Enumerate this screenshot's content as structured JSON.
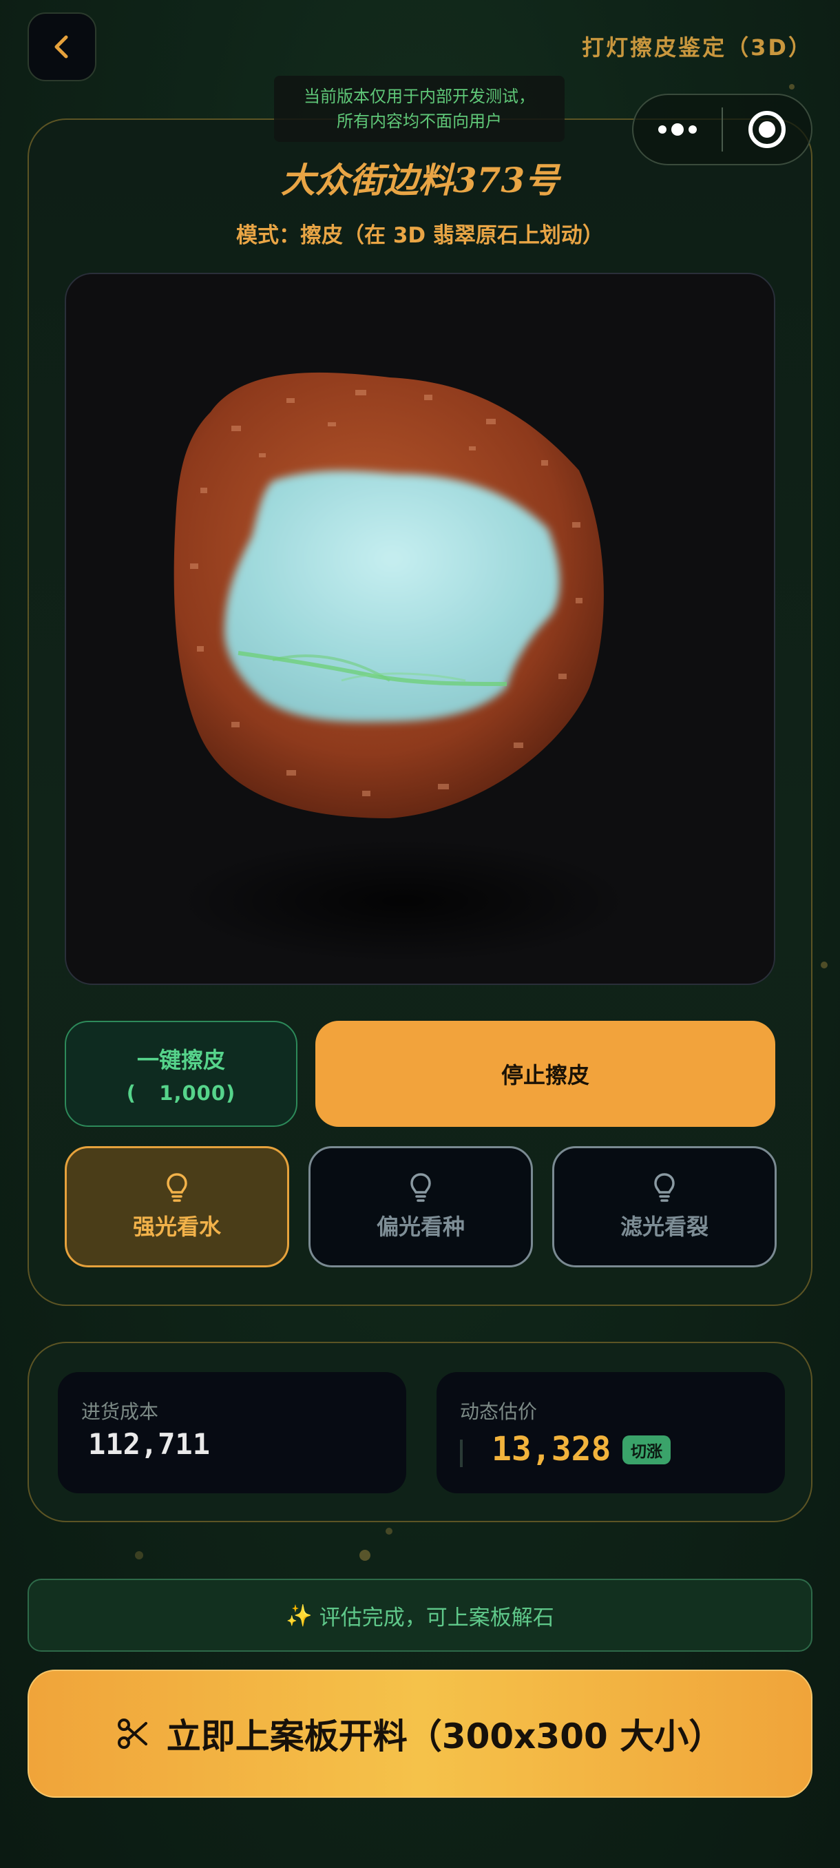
{
  "header": {
    "back_label": "<",
    "page_title": "打灯擦皮鉴定（3D）",
    "dev_notice_line1": "当前版本仅用于内部开发测试，",
    "dev_notice_line2": "所有内容均不面向用户"
  },
  "stone": {
    "title": "大众街边料373号",
    "mode": "模式：擦皮（在 3D 翡翠原石上划动）"
  },
  "actions": {
    "one_click_label": "一键擦皮",
    "one_click_cost": "(   1,000)",
    "stop_label": "停止擦皮"
  },
  "lights": [
    {
      "label": "强光看水",
      "active": true,
      "icon": "bulb-icon"
    },
    {
      "label": "偏光看种",
      "active": false,
      "icon": "bulb-icon"
    },
    {
      "label": "滤光看裂",
      "active": false,
      "icon": "bulb-icon"
    }
  ],
  "stats": {
    "cost_label": "进货成本",
    "cost_value": "112,711",
    "estimate_label": "动态估价",
    "estimate_value": "13,328",
    "estimate_badge": "切涨"
  },
  "status": {
    "spark": "✨",
    "text": "评估完成，可上案板解石"
  },
  "cta": {
    "icon": "scissors-icon",
    "label": "立即上案板开料（300x300 大小）"
  },
  "colors": {
    "accent": "#f2a33c",
    "gold_text": "#e9a545",
    "green_text": "#56d48b",
    "background": "#0f2418"
  }
}
